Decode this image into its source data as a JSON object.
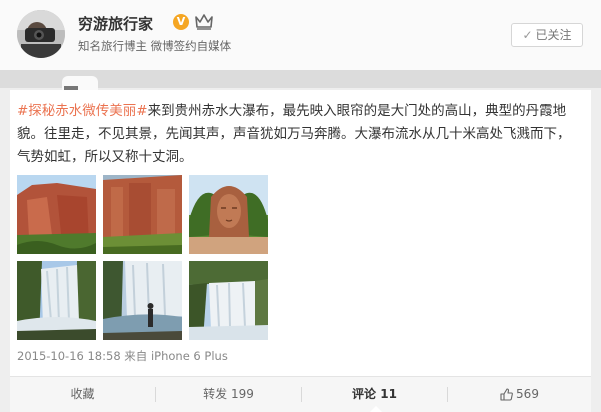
{
  "header": {
    "username": "穷游旅行家",
    "verified_mark": "V",
    "subtitle": "知名旅行博主 微博签约自媒体",
    "follow_button": {
      "check": "✓",
      "label": "已关注"
    }
  },
  "post": {
    "topic": "#探秘赤水微传美丽#",
    "text": "来到贵州赤水大瀑布，最先映入眼帘的是大门处的高山，典型的丹霞地貌。往里走，不见其景，先闻其声，声音犹如万马奔腾。大瀑布流水从几十米高处飞溅而下，气势如虹，所以又称十丈洞。",
    "images": [
      {
        "subject": "red-cliff"
      },
      {
        "subject": "red-cliff-wall"
      },
      {
        "subject": "stone-face-gate"
      },
      {
        "subject": "waterfall"
      },
      {
        "subject": "waterfall-with-person"
      },
      {
        "subject": "waterfall-rock"
      }
    ],
    "timestamp": "2015-10-16 18:58",
    "source": "来自 iPhone 6 Plus"
  },
  "actions": {
    "favorite": "收藏",
    "repost": "转发 199",
    "comment": "评论 11",
    "like_count": "569"
  },
  "colors": {
    "topic": "#eb7350",
    "verified": "#f5a623"
  }
}
